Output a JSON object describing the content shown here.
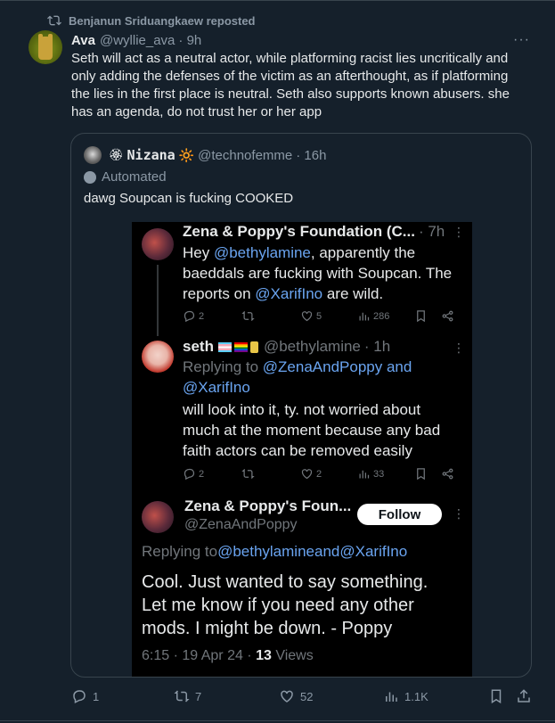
{
  "repost": {
    "text": "Benjanun Sriduangkaew reposted"
  },
  "tweet": {
    "name": "Ava",
    "handle": "@wyllie_ava",
    "time": "· 9h",
    "lines": [
      "Seth will act as a neutral actor, while platforming racist lies uncritically and",
      "only adding the defenses of the victim as an afterthought, as if platforming",
      "the lies in the first place is neutral. Seth also supports known abusers. she",
      "has an agenda, do not trust her or her app"
    ],
    "more": "···"
  },
  "quote": {
    "name_prefix": "🏵",
    "name": "Nizana",
    "name_suffix": "🔆",
    "handle": "@technofemme",
    "time": "· 16h",
    "automated": "Automated",
    "text": "dawg Soupcan is fucking COOKED",
    "shot": {
      "post1": {
        "name": "Zena & Poppy's Foundation (C...",
        "time": "· 7h",
        "line1_pre": "Hey ",
        "line1_link": "@bethylamine",
        "line1_post": ", apparently the",
        "line2": "baeddals are fucking with Soupcan. The",
        "line3_pre": "reports on ",
        "line3_link": "@XarifIno",
        "line3_post": " are wild.",
        "replies": "2",
        "likes": "5",
        "views": "286"
      },
      "post2": {
        "name": "seth",
        "handle": "@bethylamine",
        "time": "· 1h",
        "replying_pre": "Replying to ",
        "replying_link1": "@ZenaAndPoppy",
        "replying_and": " and",
        "replying_link2": "@XarifIno",
        "line1": "will look into it, ty. not worried about",
        "line2": "much at the moment because any bad",
        "line3": "faith actors can be removed easily",
        "replies": "2",
        "likes": "2",
        "views": "33"
      },
      "post3": {
        "name": "Zena & Poppy's Foun...",
        "handle": "@ZenaAndPoppy",
        "follow": "Follow",
        "replying_pre": "Replying to ",
        "replying_link1": "@bethylamine",
        "replying_and": " and ",
        "replying_link2": "@XarifIno",
        "line1": "Cool. Just wanted to say something.",
        "line2": "Let me know if you need any other",
        "line3": "mods. I might be down. - Poppy",
        "stamp_date": "6:15 · 19 Apr 24 · ",
        "stamp_views": "13",
        "stamp_views_label": " Views"
      }
    }
  },
  "actions": {
    "replies": "1",
    "reposts": "7",
    "likes": "52",
    "views": "1.1K"
  },
  "colors": {
    "background": "#15202b",
    "accent_link": "#6aa4f0",
    "muted": "#8b98a5"
  }
}
